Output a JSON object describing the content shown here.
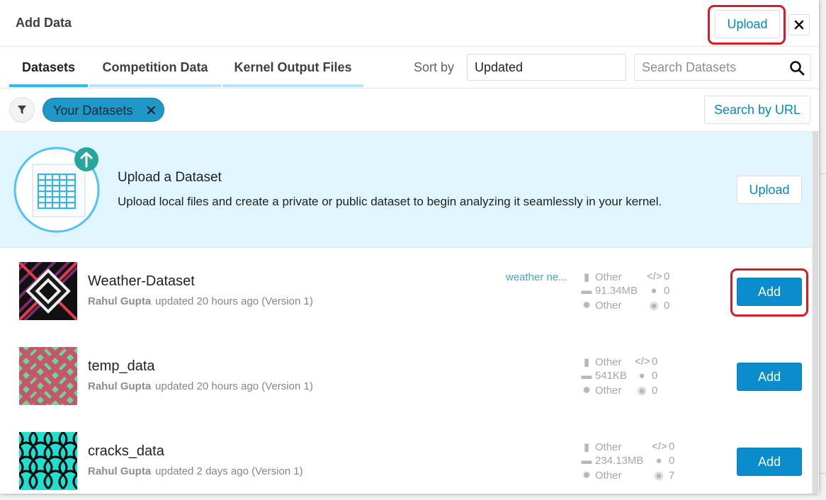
{
  "dialog": {
    "title": "Add Data",
    "upload_label": "Upload",
    "close_label": "✕"
  },
  "tabs": [
    {
      "label": "Datasets",
      "active": true
    },
    {
      "label": "Competition Data",
      "active": false
    },
    {
      "label": "Kernel Output Files",
      "active": false
    }
  ],
  "sort": {
    "label": "Sort by",
    "value": "Updated"
  },
  "search": {
    "placeholder": "Search Datasets",
    "value": ""
  },
  "filter": {
    "chip_label": "Your Datasets",
    "chip_remove": "✕",
    "search_by_url_label": "Search by URL"
  },
  "upload_banner": {
    "title": "Upload a Dataset",
    "description": "Upload local files and create a private or public dataset to begin analyzing it seamlessly in your kernel.",
    "button_label": "Upload"
  },
  "datasets": [
    {
      "name": "Weather-Dataset",
      "owner": "Rahul Gupta",
      "updated": "updated 20 hours ago (Version 1)",
      "tag": "weather ne...",
      "file_type": "Other",
      "size": "91.34MB",
      "license": "Other",
      "kernels": "0",
      "comments": "0",
      "views": "0",
      "add_label": "Add"
    },
    {
      "name": "temp_data",
      "owner": "Rahul Gupta",
      "updated": "updated 20 hours ago (Version 1)",
      "tag": "",
      "file_type": "Other",
      "size": "541KB",
      "license": "Other",
      "kernels": "0",
      "comments": "0",
      "views": "0",
      "add_label": "Add"
    },
    {
      "name": "cracks_data",
      "owner": "Rahul Gupta",
      "updated": "updated 2 days ago (Version 1)",
      "tag": "",
      "file_type": "Other",
      "size": "234.13MB",
      "license": "Other",
      "kernels": "0",
      "comments": "0",
      "views": "7",
      "add_label": "Add"
    }
  ],
  "colors": {
    "accent": "#008abc",
    "add_button": "#0b8ccd",
    "chip": "#1f97c7",
    "banner_bg": "#e1f5fe",
    "highlight": "#d81b24"
  }
}
